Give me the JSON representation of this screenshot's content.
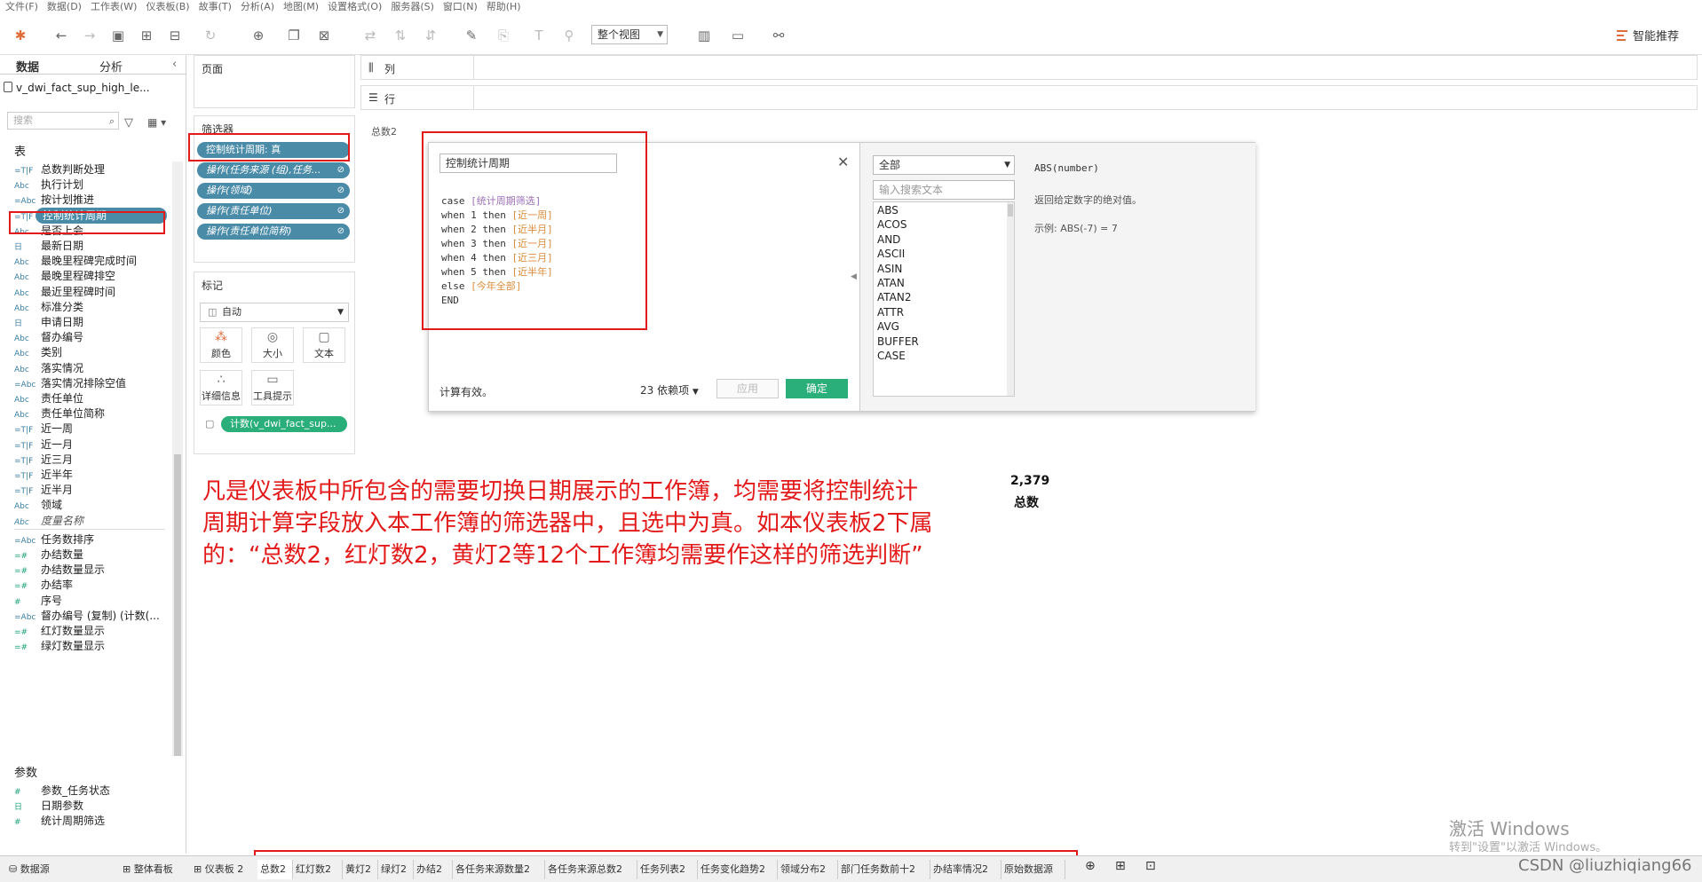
{
  "menu": [
    "文件(F)",
    "数据(D)",
    "工作表(W)",
    "仪表板(B)",
    "故事(T)",
    "分析(A)",
    "地图(M)",
    "设置格式(O)",
    "服务器(S)",
    "窗口(N)",
    "帮助(H)"
  ],
  "toolbar": {
    "view_select": "整个视图",
    "smart_label": "智能推荐"
  },
  "datapane": {
    "tab_data": "数据",
    "tab_analysis": "分析",
    "datasource": "v_dwi_fact_sup_high_le...",
    "search_placeholder": "搜索",
    "section_tables": "表",
    "section_params": "参数",
    "fields": [
      {
        "type": "=T|F",
        "name": "总数判断处理"
      },
      {
        "type": "Abc",
        "name": "执行计划"
      },
      {
        "type": "=Abc",
        "name": "按计划推进"
      },
      {
        "type": "=T|F",
        "name": "控制统计周期"
      },
      {
        "type": "Abc",
        "name": "是否上会"
      },
      {
        "type": "日",
        "name": "最新日期"
      },
      {
        "type": "Abc",
        "name": "最晚里程碑完成时间"
      },
      {
        "type": "Abc",
        "name": "最晚里程碑排空"
      },
      {
        "type": "Abc",
        "name": "最近里程碑时间"
      },
      {
        "type": "Abc",
        "name": "标准分类"
      },
      {
        "type": "日",
        "name": "申请日期"
      },
      {
        "type": "Abc",
        "name": "督办编号"
      },
      {
        "type": "Abc",
        "name": "类别"
      },
      {
        "type": "Abc",
        "name": "落实情况"
      },
      {
        "type": "=Abc",
        "name": "落实情况排除空值"
      },
      {
        "type": "Abc",
        "name": "责任单位"
      },
      {
        "type": "Abc",
        "name": "责任单位简称"
      },
      {
        "type": "=T|F",
        "name": "近一周"
      },
      {
        "type": "=T|F",
        "name": "近一月"
      },
      {
        "type": "=T|F",
        "name": "近三月"
      },
      {
        "type": "=T|F",
        "name": "近半年"
      },
      {
        "type": "=T|F",
        "name": "近半月"
      },
      {
        "type": "Abc",
        "name": "领域"
      },
      {
        "type": "Abc",
        "name": "度量名称"
      },
      {
        "type": "=Abc",
        "name": "任务数排序"
      },
      {
        "type": "=#",
        "name": "办结数量"
      },
      {
        "type": "=#",
        "name": "办结数量显示"
      },
      {
        "type": "=#",
        "name": "办结率"
      },
      {
        "type": "#",
        "name": "序号"
      },
      {
        "type": "=Abc",
        "name": "督办编号 (复制) (计数(..."
      },
      {
        "type": "=#",
        "name": "红灯数量显示"
      },
      {
        "type": "=#",
        "name": "绿灯数量显示"
      }
    ],
    "params": [
      {
        "type": "#",
        "name": "参数_任务状态"
      },
      {
        "type": "日",
        "name": "日期参数"
      },
      {
        "type": "#",
        "name": "统计周期筛选"
      }
    ]
  },
  "shelves": {
    "pages": "页面",
    "columns": "列",
    "rows": "行",
    "filters": "筛选器",
    "filter_pills": [
      "控制统计周期: 真",
      "操作(任务来源 (组),任务...",
      "操作(领域)",
      "操作(责任单位)",
      "操作(责任单位简称)"
    ],
    "marks": "标记",
    "mark_type": "自动",
    "mark_buttons": [
      "颜色",
      "大小",
      "文本",
      "详细信息",
      "工具提示"
    ],
    "mark_pill": "计数(v_dwi_fact_sup..."
  },
  "worksheet_title": "总数2",
  "calc": {
    "name": "控制统计周期",
    "code": [
      {
        "kw": "case ",
        "arg": "[统计周期筛选]",
        "cls": "pv"
      },
      {
        "kw": "when 1 then ",
        "arg": "[近一周]",
        "cls": "br"
      },
      {
        "kw": "when 2 then ",
        "arg": "[近半月]",
        "cls": "br"
      },
      {
        "kw": "when 3 then ",
        "arg": "[近一月]",
        "cls": "br"
      },
      {
        "kw": "when 4 then ",
        "arg": "[近三月]",
        "cls": "br"
      },
      {
        "kw": "when 5 then ",
        "arg": "[近半年]",
        "cls": "br"
      },
      {
        "kw": "else ",
        "arg": "[今年全部]",
        "cls": "br"
      },
      {
        "kw": "END",
        "arg": "",
        "cls": "br"
      }
    ],
    "status": "计算有效。",
    "deps": "23 依赖项",
    "apply": "应用",
    "ok": "确定",
    "fn_category": "全部",
    "fn_search_placeholder": "输入搜索文本",
    "functions": [
      "ABS",
      "ACOS",
      "AND",
      "ASCII",
      "ASIN",
      "ATAN",
      "ATAN2",
      "ATTR",
      "AVG",
      "BUFFER",
      "CASE"
    ],
    "fn_signature": "ABS(number)",
    "fn_description": "返回给定数字的绝对值。",
    "fn_example": "示例: ABS(-7) = 7"
  },
  "annotation": "凡是仪表板中所包含的需要切换日期展示的工作簿，均需要将控制统计周期计算字段放入本工作簿的筛选器中，且选中为真。如本仪表板2下属的：“总数2，红灯数2，黄灯2等12个工作簿均需要作这样的筛选判断”",
  "kpi": {
    "value": "2,379",
    "label": "总数"
  },
  "bottom": {
    "datasource_tab": "数据源",
    "whole_board": "整体看板",
    "dashboard2": "仪表板 2",
    "sheets": [
      "总数2",
      "红灯数2",
      "黄灯2",
      "绿灯2",
      "办结2",
      "各任务来源数量2",
      "各任务来源总数2",
      "任务列表2",
      "任务变化趋势2",
      "领域分布2",
      "部门任务数前十2",
      "办结率情况2",
      "原始数据源"
    ]
  },
  "watermark": {
    "line1": "激活 Windows",
    "line2": "转到\"设置\"以激活 Windows。",
    "csdn": "CSDN @liuzhiqiang66"
  },
  "colors": {
    "pill": "#4a8ba8",
    "green": "#2aae7a",
    "annotation": "#e31a1a"
  }
}
